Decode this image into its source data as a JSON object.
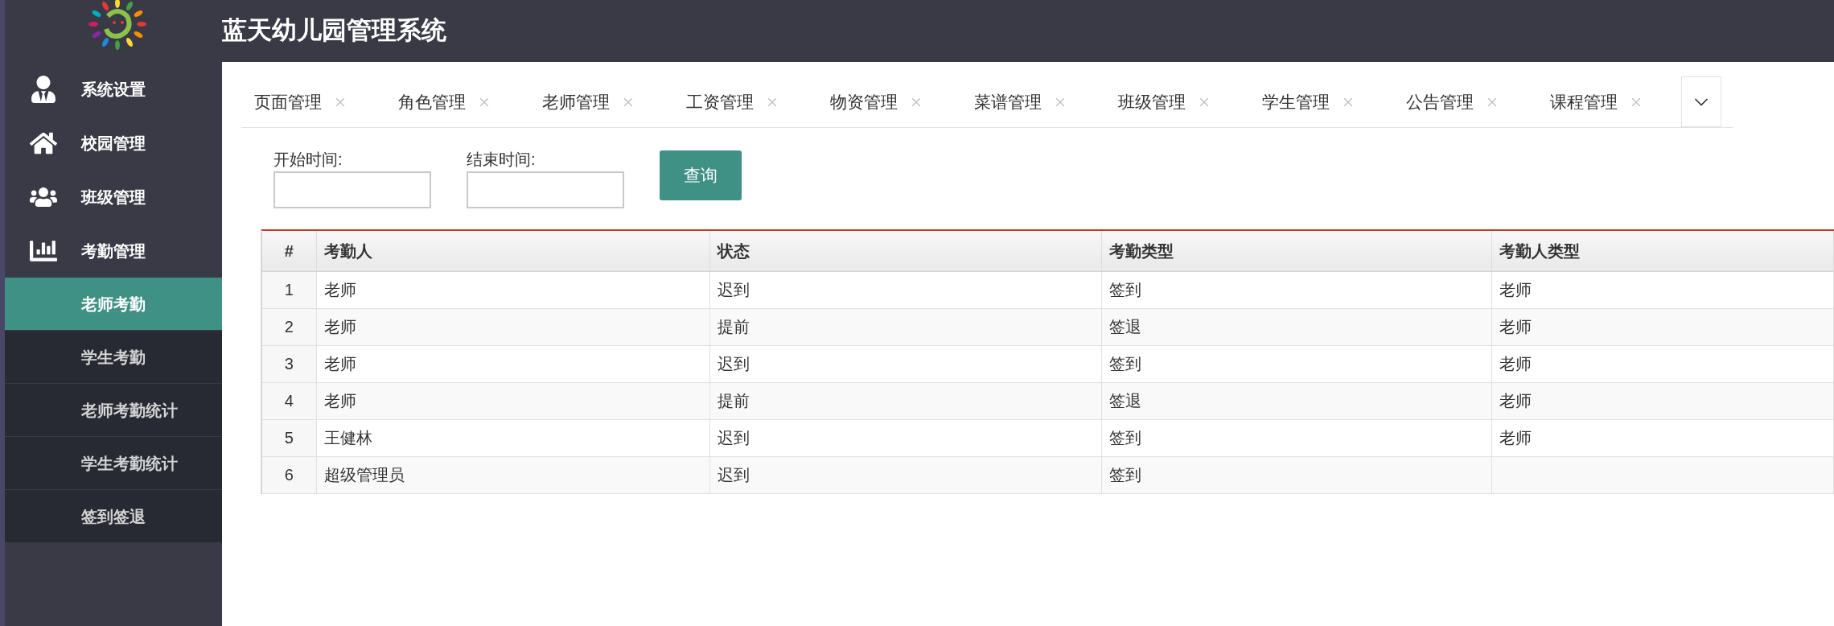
{
  "header": {
    "title": "蓝天幼儿园管理系统"
  },
  "sidebar": {
    "items": [
      {
        "label": "系统设置"
      },
      {
        "label": "校园管理"
      },
      {
        "label": "班级管理"
      },
      {
        "label": "考勤管理",
        "children": [
          {
            "label": "老师考勤",
            "selected": true
          },
          {
            "label": "学生考勤",
            "selected": false
          },
          {
            "label": "老师考勤统计",
            "selected": false
          },
          {
            "label": "学生考勤统计",
            "selected": false
          },
          {
            "label": "签到签退",
            "selected": false
          }
        ]
      }
    ]
  },
  "tabs": [
    {
      "label": "页面管理"
    },
    {
      "label": "角色管理"
    },
    {
      "label": "老师管理"
    },
    {
      "label": "工资管理"
    },
    {
      "label": "物资管理"
    },
    {
      "label": "菜谱管理"
    },
    {
      "label": "班级管理"
    },
    {
      "label": "学生管理"
    },
    {
      "label": "公告管理"
    },
    {
      "label": "课程管理"
    }
  ],
  "filters": [
    {
      "label": "开始时间:"
    },
    {
      "label": "结束时间:"
    }
  ],
  "search_button": "查询",
  "table": {
    "columns": [
      "#",
      "考勤人",
      "状态",
      "考勤类型",
      "考勤人类型"
    ],
    "rows": [
      {
        "no": "1",
        "person": "老师",
        "status": "迟到",
        "type": "签到",
        "person_type": "老师"
      },
      {
        "no": "2",
        "person": "老师",
        "status": "提前",
        "type": "签退",
        "person_type": "老师"
      },
      {
        "no": "3",
        "person": "老师",
        "status": "迟到",
        "type": "签到",
        "person_type": "老师"
      },
      {
        "no": "4",
        "person": "老师",
        "status": "提前",
        "type": "签退",
        "person_type": "老师"
      },
      {
        "no": "5",
        "person": "王健林",
        "status": "迟到",
        "type": "签到",
        "person_type": "老师"
      },
      {
        "no": "6",
        "person": "超级管理员",
        "status": "迟到",
        "type": "签到"
      }
    ]
  }
}
